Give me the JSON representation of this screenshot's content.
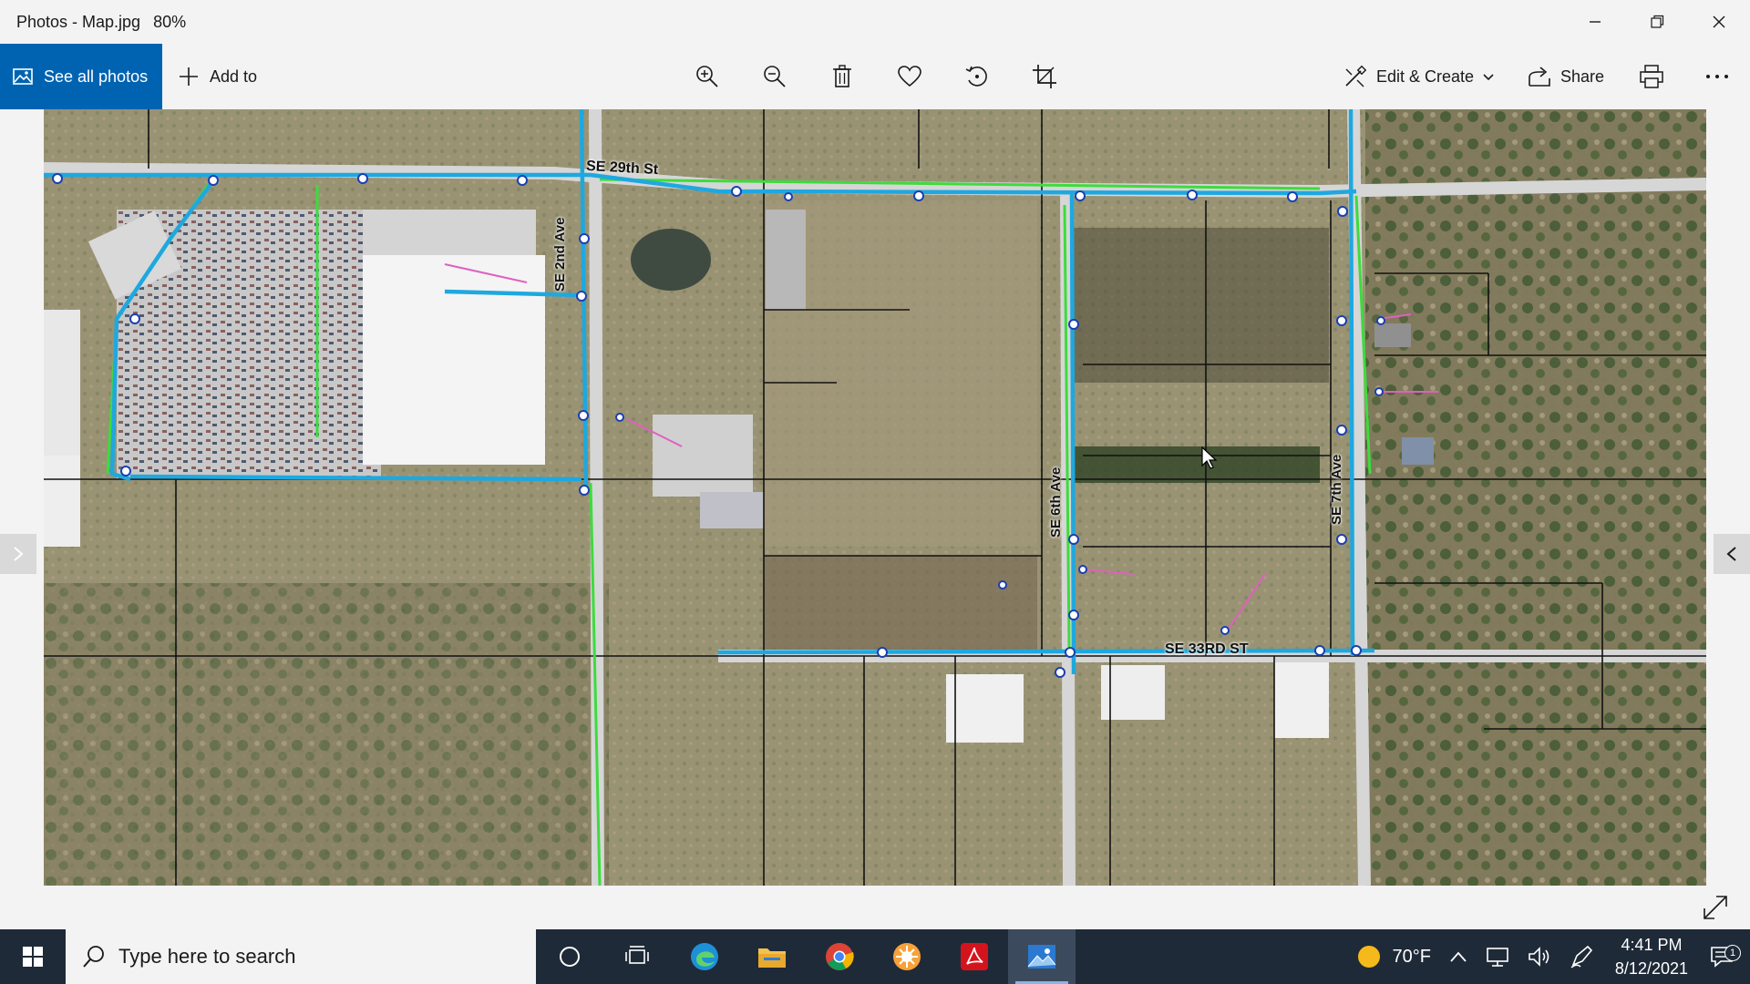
{
  "window": {
    "title": "Photos - Map.jpg",
    "zoom": "80%",
    "controls": [
      "minimize",
      "maximize",
      "close"
    ]
  },
  "toolbar": {
    "see_all_label": "See all photos",
    "add_to_label": "Add to",
    "tools": [
      "zoom-in-icon",
      "zoom-out-icon",
      "delete-icon",
      "favorite-icon",
      "rotate-icon",
      "crop-icon"
    ],
    "edit_create_label": "Edit & Create",
    "share_label": "Share",
    "print_icon": "print-icon",
    "more_icon": "more-icon"
  },
  "map": {
    "labels": {
      "street_29th": "SE 29th St",
      "ave_2nd": "SE 2nd Ave",
      "ave_6th": "SE 6th Ave",
      "ave_7th": "SE 7th Ave",
      "street_33rd": "SE 33RD ST"
    },
    "colors": {
      "water_main": "#1ea8e0",
      "green_line": "#3ddc3d",
      "parcel": "#111111",
      "service": "#e060c0",
      "hydrant": "#ffffff"
    }
  },
  "taskbar": {
    "search_placeholder": "Type here to search",
    "apps": [
      "cortana-icon",
      "task-view-icon",
      "edge-icon",
      "file-explorer-icon",
      "chrome-icon",
      "app-orange-icon",
      "acrobat-icon",
      "photos-icon"
    ],
    "weather_temp": "70°F",
    "time": "4:41 PM",
    "date": "8/12/2021",
    "notification_count": "1",
    "accent": "#0063b1"
  }
}
